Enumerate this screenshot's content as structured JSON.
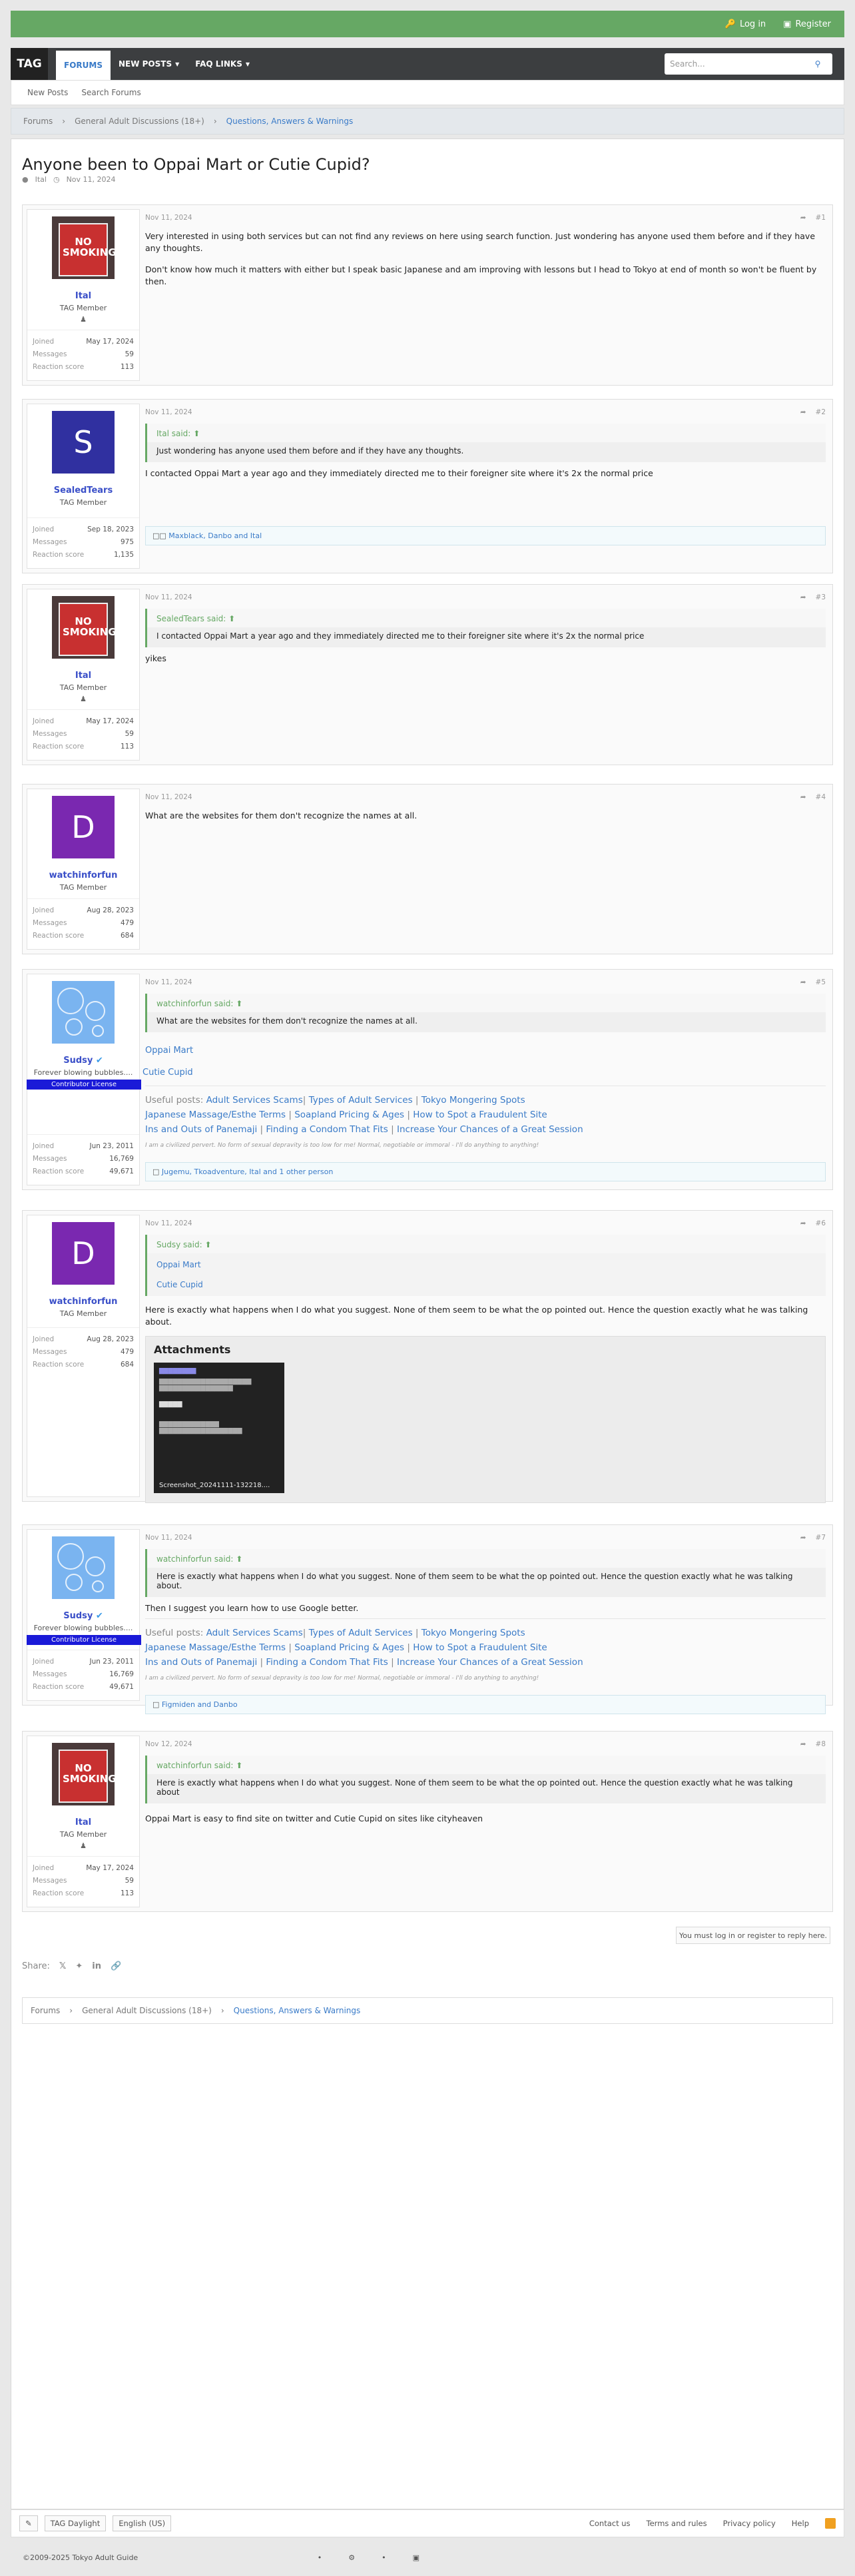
{
  "topbar": {
    "login": "Log in",
    "register": "Register"
  },
  "nav": {
    "logo": "TAG",
    "tabs": [
      "FORUMS",
      "NEW POSTS",
      "FAQ LINKS"
    ],
    "search_placeholder": "Search..."
  },
  "subnav": [
    "New Posts",
    "Search Forums"
  ],
  "breadcrumb": [
    "Forums",
    "General Adult Discussions (18+)",
    "Questions, Answers & Warnings"
  ],
  "thread": {
    "title": "Anyone been to Oppai Mart or Cutie Cupid?",
    "author": "Ital",
    "date": "Nov 11, 2024"
  },
  "labels": {
    "joined": "Joined",
    "messages": "Messages",
    "reaction": "Reaction score",
    "attachments": "Attachments",
    "useful": "Useful posts:"
  },
  "signature": {
    "links": [
      "Adult Services Scams",
      "Types of Adult Services",
      "Tokyo Mongering Spots",
      "Japanese Massage/Esthe Terms",
      "Soapland Pricing & Ages",
      "How to Spot a Fraudulent Site",
      "Ins and Outs of Panemaji",
      "Finding a Condom That Fits",
      "Increase Your Chances of a Great Session"
    ],
    "small": "I am a civilized pervert. No form of sexual depravity is too low for me! Normal, negotiable or immoral - I'll do anything to anything!"
  },
  "users": {
    "ital": {
      "name": "Ital",
      "title": "TAG Member",
      "joined": "May 17, 2024",
      "messages": "59",
      "reaction": "113"
    },
    "sealed": {
      "name": "SealedTears",
      "title": "TAG Member",
      "joined": "Sep 18, 2023",
      "messages": "975",
      "reaction": "1,135",
      "initial": "S"
    },
    "watchin": {
      "name": "watchinforfun",
      "title": "TAG Member",
      "joined": "Aug 28, 2023",
      "messages": "479",
      "reaction": "684",
      "initial": "D"
    },
    "sudsy": {
      "name": "Sudsy",
      "title": "Forever blowing bubbles....",
      "banner": "Contributor License",
      "joined": "Jun 23, 2011",
      "messages": "16,769",
      "reaction": "49,671"
    }
  },
  "posts": [
    {
      "date": "Nov 11, 2024",
      "num": "#1",
      "p1": "Very interested in using both services but can not find any reviews on here using search function. Just wondering has anyone used them before and if they have any thoughts.",
      "p2": "Don't know how much it matters with either but I speak basic Japanese and am improving with lessons but I head to Tokyo at end of month so won't be fluent by then."
    },
    {
      "date": "Nov 11, 2024",
      "num": "#2",
      "quote_author": "Ital said:",
      "quote": "Just wondering has anyone used them before and if they have any thoughts.",
      "text": "I contacted Oppai Mart a year ago and they immediately directed me to their foreigner site where it's 2x the normal price",
      "reactions": "Maxblack, Danbo and Ital"
    },
    {
      "date": "Nov 11, 2024",
      "num": "#3",
      "quote_author": "SealedTears said:",
      "quote": "I contacted Oppai Mart a year ago and they immediately directed me to their foreigner site where it's 2x the normal price",
      "text": "yikes"
    },
    {
      "date": "Nov 11, 2024",
      "num": "#4",
      "text": "What are the websites for them don't recognize the names at all."
    },
    {
      "date": "Nov 11, 2024",
      "num": "#5",
      "quote_author": "watchinforfun said:",
      "quote": "What are the websites for them don't recognize the names at all.",
      "link1": "Oppai Mart",
      "link2": "Cutie Cupid",
      "reactions": "Jugemu, Tkoadventure, Ital and 1 other person"
    },
    {
      "date": "Nov 11, 2024",
      "num": "#6",
      "quote_author": "Sudsy said:",
      "q1": "Oppai Mart",
      "q2": "Cutie Cupid",
      "text": "Here is exactly what happens when I do what you suggest. None of them seem to be what the op pointed out. Hence the question exactly what he was talking about.",
      "attach": "Screenshot_20241111-132218...."
    },
    {
      "date": "Nov 11, 2024",
      "num": "#7",
      "quote_author": "watchinforfun said:",
      "quote": "Here is exactly what happens when I do what you suggest. None of them seem to be what the op pointed out. Hence the question exactly what he was talking about.",
      "text": "Then I suggest you learn how to use Google better.",
      "reactions": "Figmiden and Danbo"
    },
    {
      "date": "Nov 12, 2024",
      "num": "#8",
      "quote_author": "watchinforfun said:",
      "quote": "Here is exactly what happens when I do what you suggest. None of them seem to be what the op pointed out. Hence the question exactly what he was talking about",
      "text": "Oppai Mart is easy to find site on twitter and Cutie Cupid on sites like cityheaven"
    }
  ],
  "reply_notice": "You must log in or register to reply here.",
  "share_label": "Share:",
  "footer": {
    "style": "TAG Daylight",
    "lang": "English (US)",
    "links": [
      "Contact us",
      "Terms and rules",
      "Privacy policy",
      "Help"
    ],
    "copyright": "©2009-2025 Tokyo Adult Guide"
  },
  "colors": {
    "accent": "#3a7bc8",
    "topbar": "#66a864",
    "navbar": "#3c3e40",
    "banner": "#1a1ad8"
  }
}
